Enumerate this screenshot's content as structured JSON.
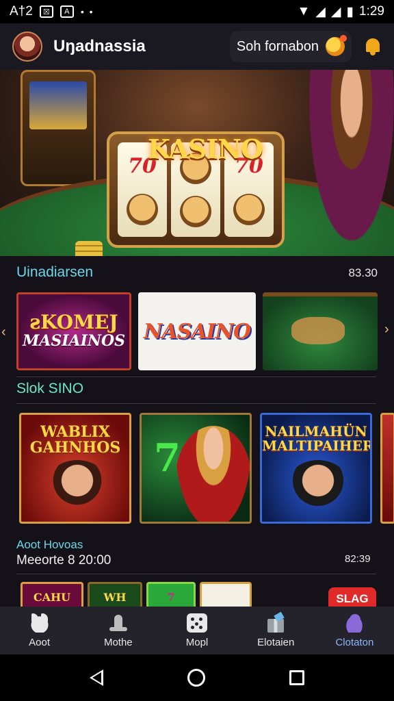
{
  "status_bar": {
    "left_text": "A†2",
    "box1": "☒",
    "box2": "A",
    "dots": "• •",
    "time": "1:29"
  },
  "header": {
    "title": "Uŋadnassia",
    "promo_text": "Soh fornabon"
  },
  "hero": {
    "logo": "KASINO",
    "reel_symbol": "70"
  },
  "section1": {
    "title": "Uinadiarsen",
    "count": "83.30",
    "cards": [
      {
        "line1": "ƨKOMEJ",
        "line2": "MASIAINOS"
      },
      {
        "line1": "NASAINO"
      },
      {
        "line1": ""
      }
    ]
  },
  "section2": {
    "title": "Slok SINO",
    "cards": [
      {
        "label": "WABLIX GAHNHOS"
      },
      {
        "label": "7"
      },
      {
        "label": "NAILMAHÜN MALTIPAIHER"
      }
    ]
  },
  "section3": {
    "title": "Aoot Hovoas",
    "subtitle": "Meeorte 8 20:00",
    "count": "82:39",
    "mini_cards": [
      "CAHU",
      "WH",
      "7",
      ""
    ],
    "badge": "SLAG"
  },
  "bottom_nav": [
    {
      "label": "Aoot",
      "icon": "cat-icon"
    },
    {
      "label": "Mothe",
      "icon": "hat-icon"
    },
    {
      "label": "Mopl",
      "icon": "dice-icon"
    },
    {
      "label": "Elotaien",
      "icon": "gift-icon"
    },
    {
      "label": "Clotaton",
      "icon": "cloud-icon",
      "active": true
    }
  ],
  "colors": {
    "accent_cyan": "#6ad8e8",
    "accent_green": "#6ae8c8",
    "active_nav": "#8ab8ff",
    "badge_red": "#e02a2a"
  }
}
